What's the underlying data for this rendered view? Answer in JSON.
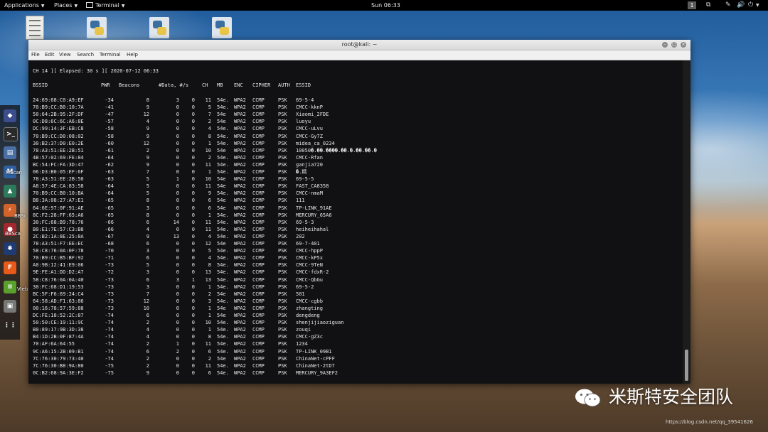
{
  "top_bar": {
    "applications": "Applications",
    "places": "Places",
    "terminal": "Terminal",
    "clock": "Sun 06:33",
    "workspace": "1"
  },
  "sidebar_labels": {
    "mscan": "MScan",
    "bbscan": "BBSc",
    "bbscan2": "BBSca",
    "vieb": "Vieb"
  },
  "window": {
    "title": "root@kali: ~",
    "menu": [
      "File",
      "Edit",
      "View",
      "Search",
      "Terminal",
      "Help"
    ]
  },
  "terminal": {
    "status_line": "CH 14 ][ Elapsed: 30 s ][ 2020-07-12 06:33",
    "headers": [
      "BSSID",
      "PWR",
      "Beacons",
      "#Data, #/s",
      "CH",
      "MB",
      "ENC",
      "CIPHER",
      "AUTH",
      "ESSID"
    ],
    "rows": [
      [
        "24:69:68:C0:A9:EF",
        "-34",
        "8",
        "3",
        "0",
        "11",
        "54e.",
        "WPA2",
        "CCMP",
        "PSK",
        "69-5-4"
      ],
      [
        "70:B9:CC:B0:10:7A",
        "-41",
        "9",
        "0",
        "0",
        "5",
        "54e.",
        "WPA2",
        "CCMP",
        "PSK",
        "CMCC-kknP"
      ],
      [
        "50:64:2B:95:2F:DF",
        "-47",
        "12",
        "0",
        "0",
        "7",
        "54e",
        "WPA2",
        "CCMP",
        "PSK",
        "Xiaomi_2FDE"
      ],
      [
        "0C:D8:6C:6C:A6:8E",
        "-57",
        "4",
        "0",
        "0",
        "2",
        "54e",
        "WPA2",
        "CCMP",
        "PSK",
        "luoyu"
      ],
      [
        "DC:99:14:3F:EB:C8",
        "-58",
        "9",
        "0",
        "0",
        "4",
        "54e.",
        "WPA2",
        "CCMP",
        "PSK",
        "CMCC-uLvu"
      ],
      [
        "70:B9:CC:D0:08:02",
        "-58",
        "9",
        "0",
        "0",
        "8",
        "54e.",
        "WPA2",
        "CCMP",
        "PSK",
        "CMCC-Gy7Z"
      ],
      [
        "30:B2:37:D0:E0:2E",
        "-60",
        "12",
        "0",
        "0",
        "1",
        "54e.",
        "WPA2",
        "CCMP",
        "PSK",
        "midea_ca_0234"
      ],
      [
        "78:A3:51:EE:2B:51",
        "-61",
        "2",
        "0",
        "0",
        "10",
        "54e",
        "WPA2",
        "CCMP",
        "PSK",
        "10050�.��.����.��.�.��.��.�"
      ],
      [
        "4B:57:02:69:FE:84",
        "-64",
        "9",
        "0",
        "0",
        "2",
        "54e.",
        "WPA2",
        "CCMP",
        "PSK",
        "CMCC-Rfan"
      ],
      [
        "BC:54:FC:FA:3D:47",
        "-62",
        "9",
        "0",
        "0",
        "11",
        "54e.",
        "WPA2",
        "CCMP",
        "PSK",
        "ganjia720"
      ],
      [
        "06:D3:B0:05:EF:6F",
        "-63",
        "7",
        "0",
        "0",
        "1",
        "54e.",
        "WPA2",
        "CCMP",
        "PSK",
        "�.精"
      ],
      [
        "78:A3:51:EE:2B:50",
        "-63",
        "5",
        "1",
        "0",
        "10",
        "54e",
        "WPA2",
        "CCMP",
        "PSK",
        "69-5-5"
      ],
      [
        "A8:57:4E:CA:83:58",
        "-64",
        "5",
        "0",
        "0",
        "11",
        "54e",
        "WPA2",
        "CCMP",
        "PSK",
        "FAST_CA8358"
      ],
      [
        "70:B9:CC:B0:10:BA",
        "-64",
        "5",
        "0",
        "0",
        "9",
        "54e.",
        "WPA2",
        "CCMP",
        "PSK",
        "CMCC-nmaM"
      ],
      [
        "B8:3A:08:27:A7:E1",
        "-65",
        "8",
        "0",
        "0",
        "6",
        "54e",
        "WPA2",
        "CCMP",
        "PSK",
        "111"
      ],
      [
        "64:6E:97:0F:91:AE",
        "-65",
        "3",
        "0",
        "0",
        "6",
        "54e",
        "WPA2",
        "CCMP",
        "PSK",
        "TP-LINK_91AE"
      ],
      [
        "8C:F2:28:FF:65:A6",
        "-65",
        "8",
        "0",
        "0",
        "1",
        "54e.",
        "WPA2",
        "CCMP",
        "PSK",
        "MERCURY_65A6"
      ],
      [
        "30:FC:68:B9:78:76",
        "-66",
        "6",
        "14",
        "0",
        "11",
        "54e.",
        "WPA2",
        "CCMP",
        "PSK",
        "69-5-3"
      ],
      [
        "B0:E1:7E:57:C3:B8",
        "-66",
        "4",
        "0",
        "0",
        "11",
        "54e.",
        "WPA2",
        "CCMP",
        "PSK",
        "heiheihahal"
      ],
      [
        "2C:B2:1A:8E:25:8A",
        "-67",
        "9",
        "13",
        "0",
        "4",
        "54e.",
        "WPA2",
        "CCMP",
        "PSK",
        "202"
      ],
      [
        "78:A3:51:F7:EE:EC",
        "-68",
        "6",
        "0",
        "0",
        "12",
        "54e",
        "WPA2",
        "CCMP",
        "PSK",
        "69-7-401"
      ],
      [
        "58:C8:76:0A:0F:78",
        "-70",
        "3",
        "0",
        "0",
        "5",
        "54e.",
        "WPA2",
        "CCMP",
        "PSK",
        "CMCC-hppP"
      ],
      [
        "70:B9:CC:B5:BF:92",
        "-71",
        "6",
        "0",
        "0",
        "4",
        "54e.",
        "WPA2",
        "CCMP",
        "PSK",
        "CMCC-kP5x"
      ],
      [
        "A0:9B:12:41:E9:06",
        "-73",
        "5",
        "0",
        "0",
        "8",
        "54e.",
        "WPA2",
        "CCMP",
        "PSK",
        "CMCC-9TeN"
      ],
      [
        "9E:FE:A1:DD:D2:A7",
        "-72",
        "3",
        "0",
        "0",
        "13",
        "54e.",
        "WPA2",
        "CCMP",
        "PSK",
        "CMCC-fdxR-2"
      ],
      [
        "58:C8:76:0A:0A:40",
        "-73",
        "6",
        "3",
        "1",
        "13",
        "54e.",
        "WPA2",
        "CCMP",
        "PSK",
        "CMCC-QbGu"
      ],
      [
        "30:FC:68:D1:19:53",
        "-73",
        "3",
        "0",
        "0",
        "1",
        "54e.",
        "WPA2",
        "CCMP",
        "PSK",
        "69-5-2"
      ],
      [
        "BC:5F:F6:69:24:C4",
        "-73",
        "7",
        "0",
        "0",
        "2",
        "54e",
        "WPA2",
        "CCMP",
        "PSK",
        "501"
      ],
      [
        "64:58:AD:F1:63:86",
        "-73",
        "12",
        "0",
        "0",
        "3",
        "54e.",
        "WPA2",
        "CCMP",
        "PSK",
        "CMCC-cgbb"
      ],
      [
        "00:16:78:57:59:88",
        "-73",
        "10",
        "0",
        "0",
        "1",
        "54e",
        "WPA2",
        "CCMP",
        "PSK",
        "zhangting"
      ],
      [
        "DC:FE:18:52:2C:87",
        "-74",
        "6",
        "0",
        "0",
        "1",
        "54e",
        "WPA2",
        "CCMP",
        "PSK",
        "dengdeng"
      ],
      [
        "50:50:CE:19:11:9C",
        "-74",
        "2",
        "0",
        "0",
        "10",
        "54e.",
        "WPA2",
        "CCMP",
        "PSK",
        "shenjijiaoziguan"
      ],
      [
        "B0:89:17:9B:3D:38",
        "-74",
        "4",
        "0",
        "0",
        "1",
        "54e.",
        "WPA2",
        "CCMP",
        "PSK",
        "zouqi"
      ],
      [
        "B4:1D:2B:0F:87:4A",
        "-74",
        "4",
        "0",
        "0",
        "8",
        "54e.",
        "WPA2",
        "CCMP",
        "PSK",
        "CMCC-gZ3c"
      ],
      [
        "70:AF:6A:64:55",
        "-74",
        "2",
        "1",
        "0",
        "11",
        "54e.",
        "WPA2",
        "CCMP",
        "PSK",
        "1234"
      ],
      [
        "9C:A6:15:2B:09:B1",
        "-74",
        "6",
        "2",
        "0",
        "6",
        "54e.",
        "WPA2",
        "CCMP",
        "PSK",
        "TP-LINK_09B1"
      ],
      [
        "7C:76:30:79:73:40",
        "-74",
        "2",
        "0",
        "0",
        "2",
        "54e",
        "WPA2",
        "CCMP",
        "PSK",
        "ChinaNet-cPFF"
      ],
      [
        "7C:76:30:B8:9A:80",
        "-75",
        "2",
        "0",
        "0",
        "11",
        "54e.",
        "WPA2",
        "CCMP",
        "PSK",
        "ChinaNet-2tD7"
      ],
      [
        "0C:B2:68:9A:3E:F2",
        "-75",
        "9",
        "0",
        "0",
        "6",
        "54e.",
        "WPA2",
        "CCMP",
        "PSK",
        "MERCURY_9A3EF2"
      ]
    ]
  },
  "watermark": {
    "text": "米斯特安全团队",
    "url": "https://blog.csdn.net/qq_39541626"
  }
}
